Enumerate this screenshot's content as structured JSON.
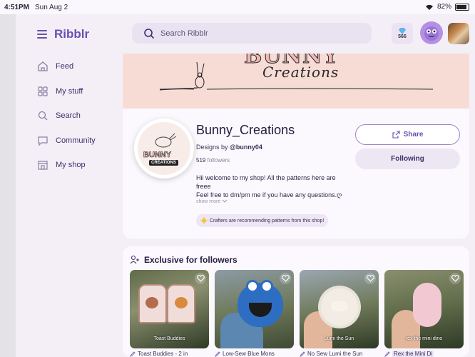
{
  "status_bar": {
    "time": "4:51PM",
    "date": "Sun Aug 2",
    "battery": "82%"
  },
  "app": {
    "brand": "Ribblr"
  },
  "search": {
    "placeholder": "Search Ribblr"
  },
  "header": {
    "gems_count": "566"
  },
  "sidebar": {
    "items": [
      {
        "label": "Feed",
        "icon": "home-icon"
      },
      {
        "label": "My stuff",
        "icon": "grid-icon"
      },
      {
        "label": "Search",
        "icon": "search-icon"
      },
      {
        "label": "Community",
        "icon": "chat-icon"
      },
      {
        "label": "My shop",
        "icon": "shop-icon"
      }
    ]
  },
  "banner": {
    "title": "BUNNY",
    "subtitle": "Creations"
  },
  "profile": {
    "logo_text_1": "BUNNY",
    "logo_text_2": "CREATIONS",
    "name": "Bunny_Creations",
    "designs_by_prefix": "Designs by",
    "designer": "@bunny04",
    "follower_count": "519",
    "follower_label": "followers",
    "bio_line1": "Hii welcome to my shop! All the patterns here are freee",
    "bio_line2": "Feel free to dm/pm me if you have any questions.ღ",
    "show_more": "show more",
    "recommendation": "Crafters are recommending patterns from this shop!",
    "share_label": "Share",
    "follow_label": "Following"
  },
  "exclusive": {
    "heading": "Exclusive for followers",
    "items": [
      {
        "title": "Toast Buddies - 2 in",
        "caption": "Toast Buddies"
      },
      {
        "title": "Low-Sew Blue Mons",
        "caption": ""
      },
      {
        "title": "No Sew Lumi the Sun",
        "caption": "Lumi the Sun"
      },
      {
        "title": "Rex the Mini Di",
        "caption": "rex the mini dino"
      }
    ]
  },
  "colors": {
    "accent": "#6a4fae",
    "background": "#f4eff7",
    "card": "#fbf9fd",
    "banner": "#f7dcd6"
  }
}
